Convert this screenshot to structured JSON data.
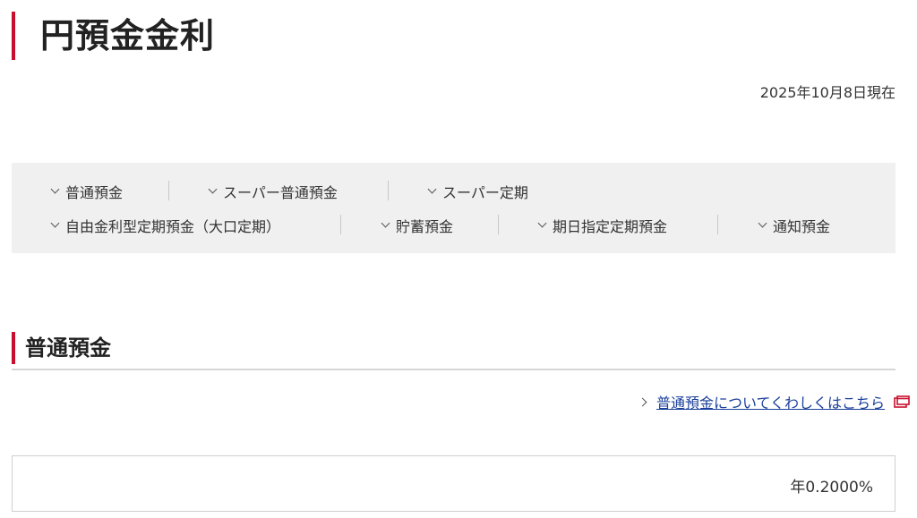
{
  "page": {
    "title": "円預金金利",
    "as_of": "2025年10月8日現在"
  },
  "anchor_nav": {
    "row1": [
      {
        "label": "普通預金"
      },
      {
        "label": "スーパー普通預金"
      },
      {
        "label": "スーパー定期"
      }
    ],
    "row2": [
      {
        "label": "自由金利型定期預金（大口定期）"
      },
      {
        "label": "貯蓄預金"
      },
      {
        "label": "期日指定定期預金"
      },
      {
        "label": "通知預金"
      }
    ]
  },
  "section": {
    "title": "普通預金",
    "detail_link": "普通預金についてくわしくはこちら",
    "rate": "年0.2000%"
  },
  "colors": {
    "accent": "#c8102e",
    "link": "#1a3f9a",
    "nav_bg": "#f0f0f0"
  },
  "icons": {
    "nav_chevron": "chevron-down-icon",
    "link_arrow": "chevron-right-icon",
    "external": "new-window-icon"
  }
}
